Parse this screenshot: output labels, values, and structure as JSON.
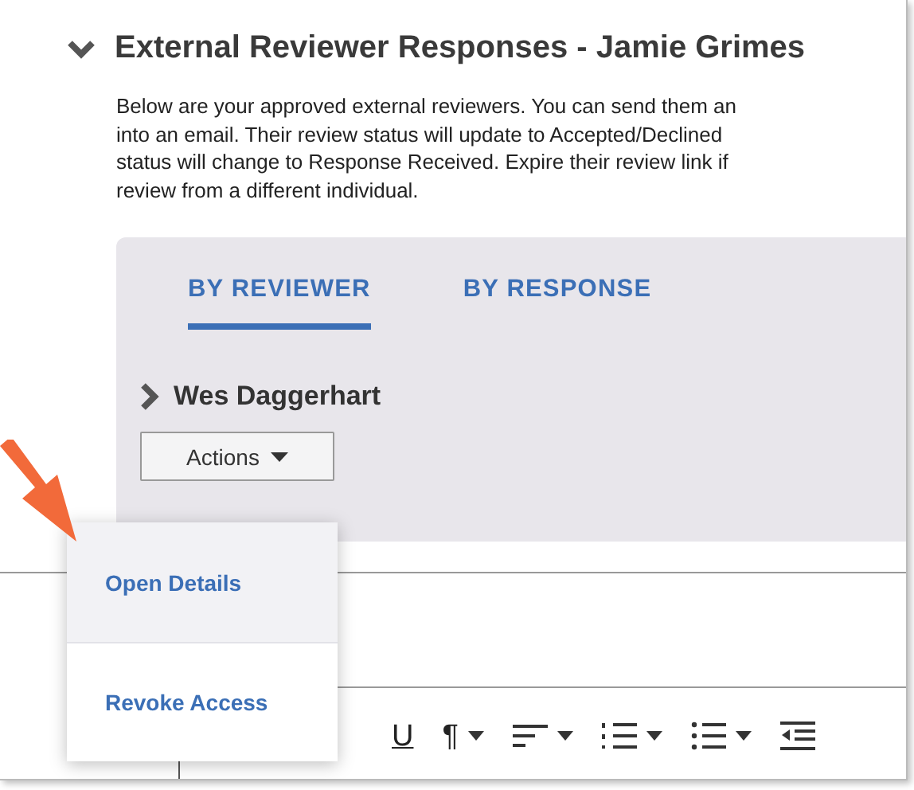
{
  "section": {
    "title": "External Reviewer Responses - Jamie Grimes",
    "expanded": true,
    "description_lines": [
      "Below are your approved external reviewers. You can send them an",
      "into an email. Their review status will update to Accepted/Declined",
      "status will change to Response Received. Expire their review link if",
      "review from a different individual."
    ]
  },
  "tabs": [
    {
      "label": "BY REVIEWER",
      "selected": true
    },
    {
      "label": "BY RESPONSE",
      "selected": false
    }
  ],
  "reviewers": [
    {
      "name": "Wes Daggerhart",
      "expanded": false,
      "actions_button": "Actions"
    }
  ],
  "actions_menu": {
    "items": [
      {
        "label": "Open Details",
        "highlighted": true
      },
      {
        "label": "Revoke Access",
        "highlighted": false
      }
    ]
  },
  "toolbar": [
    {
      "kind": "underline",
      "text": "U",
      "menu": false
    },
    {
      "kind": "glyph",
      "text": "¶",
      "menu": true
    },
    {
      "kind": "align",
      "menu": true
    },
    {
      "kind": "numbered",
      "menu": true
    },
    {
      "kind": "bullets",
      "menu": true
    },
    {
      "kind": "outdent",
      "menu": false
    }
  ]
}
